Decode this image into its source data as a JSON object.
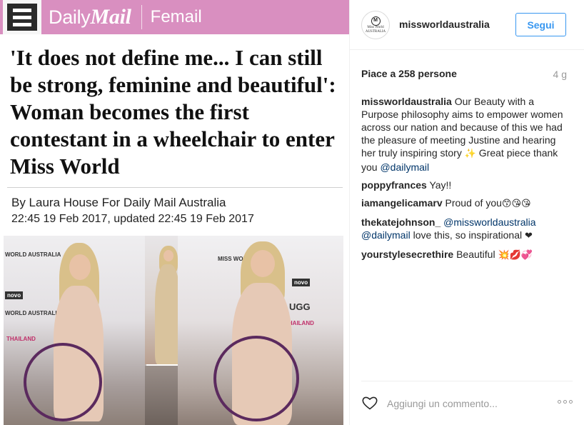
{
  "article": {
    "brand_regular": "Daily",
    "brand_bold": "Mail",
    "section": "Femail",
    "headline": "'It does not define me... I can still be strong, feminine and beautiful': Woman becomes the first contestant in a wheelchair to enter Miss World",
    "byline": "By Laura House For Daily Mail Australia",
    "dates": "22:45 19 Feb 2017, updated 22:45 19 Feb 2017",
    "backdrop_text": {
      "world_australia": "WORLD AUSTRALIA",
      "miss_world": "MISS WORLD",
      "novo": "novo",
      "ugg": "UGG",
      "thailand": "THAILAND"
    }
  },
  "account": {
    "username": "missworldaustralia",
    "avatar_line1": "Miss World",
    "avatar_line2": "AUSTRALIA",
    "avatar_mark": "M",
    "follow_label": "Segui"
  },
  "stats": {
    "likes": "Piace a 258 persone",
    "time_ago": "4 g"
  },
  "comments": [
    {
      "user": "missworldaustralia",
      "text": " Our Beauty with a Purpose philosophy aims to empower women across our nation and because of this we had the pleasure of meeting Justine and hearing her truly inspiring story ",
      "emoji": "✨",
      "text2": " Great piece thank you ",
      "mention": "@dailymail"
    },
    {
      "user": "poppyfrances",
      "text": " Yay!!"
    },
    {
      "user": "iamangelicamarv",
      "text": " Proud of you",
      "emoji": "😙😘😘"
    },
    {
      "user": "thekatejohnson_",
      "mention1": " @missworldaustralia",
      "mention2": "@dailymail",
      "text": " love this, so inspirational ",
      "emoji": "❤"
    },
    {
      "user": "yourstylesecrethire",
      "text": " Beautiful ",
      "emoji": "💥💋💞"
    }
  ],
  "footer": {
    "comment_placeholder": "Aggiungi un commento...",
    "like_icon": "heart-outline-icon",
    "more_icon": "more-options-icon"
  },
  "colors": {
    "accent_blue": "#3897f0",
    "dailymail_pink": "#d98fc0",
    "mention_blue": "#003569"
  }
}
